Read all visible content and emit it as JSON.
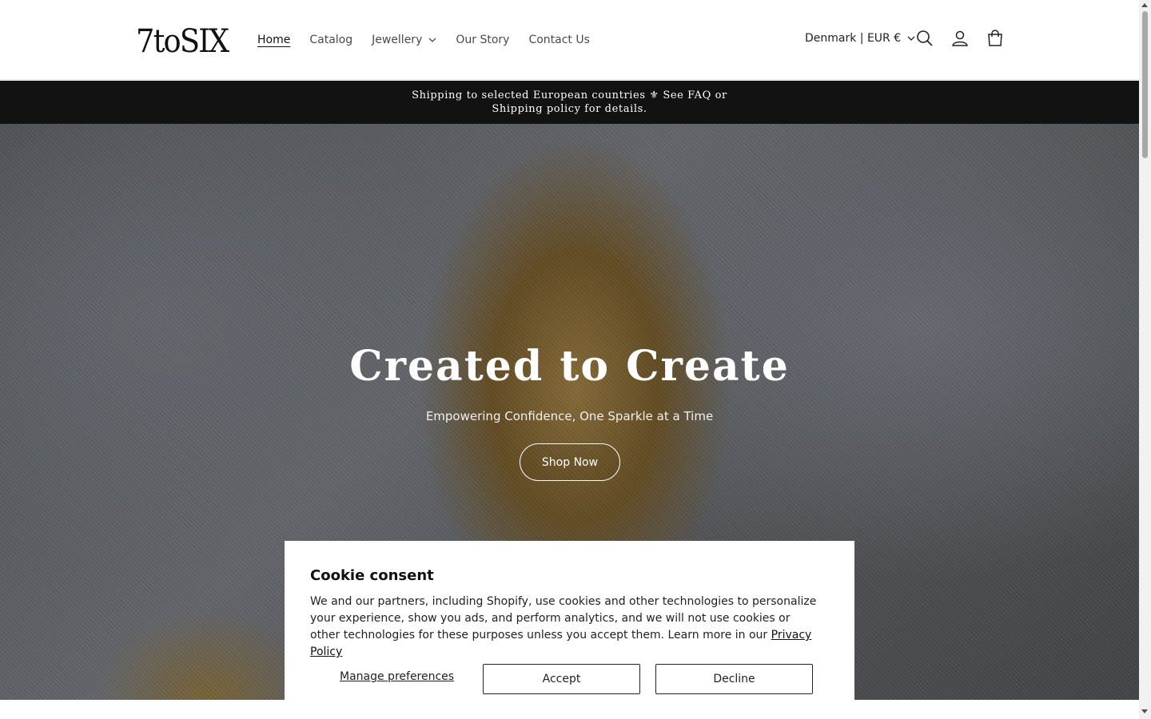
{
  "header": {
    "logo": "7toSIX",
    "nav": [
      {
        "label": "Home",
        "active": true
      },
      {
        "label": "Catalog"
      },
      {
        "label": "Jewellery",
        "has_dropdown": true
      },
      {
        "label": "Our Story"
      },
      {
        "label": "Contact Us"
      }
    ],
    "country_selector": "Denmark | EUR €",
    "icons": [
      "search-icon",
      "account-icon",
      "cart-icon"
    ]
  },
  "announcement": {
    "text": "Shipping to selected European countries ⚜ See FAQ or Shipping policy for details."
  },
  "hero": {
    "title": "Created to Create",
    "subtitle": "Empowering Confidence, One Sparkle at a Time",
    "button_label": "Shop Now"
  },
  "cookie": {
    "title": "Cookie consent",
    "body": "We and our partners, including Shopify, use cookies and other technologies to personalize your experience, show you ads, and perform analytics, and we will not use cookies or other technologies for these purposes unless you accept them. Learn more in our ",
    "privacy_link": "Privacy Policy",
    "manage_label": "Manage preferences",
    "accept_label": "Accept",
    "decline_label": "Decline"
  },
  "colors": {
    "announcement_bg": "#121212",
    "text": "#121212"
  }
}
